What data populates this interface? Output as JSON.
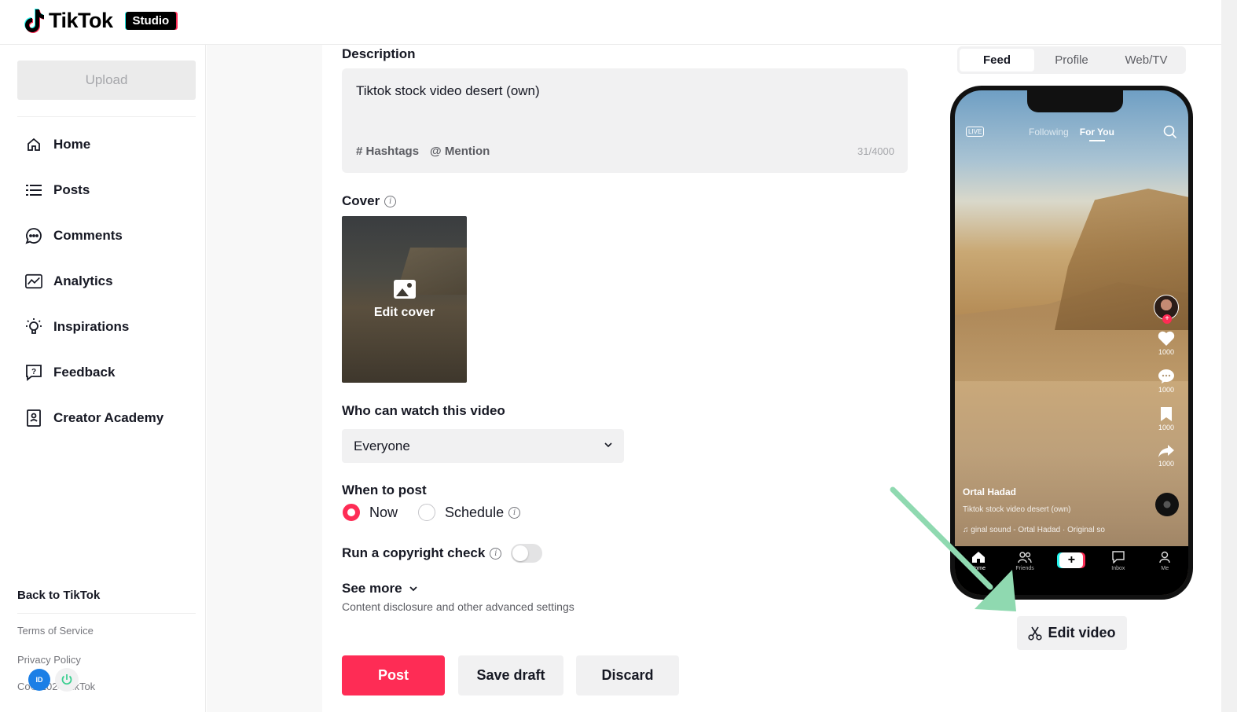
{
  "brand": {
    "logo_text": "TikTok",
    "badge": "Studio"
  },
  "sidebar": {
    "upload_label": "Upload",
    "items": [
      {
        "label": "Home",
        "icon": "home-icon"
      },
      {
        "label": "Posts",
        "icon": "list-icon"
      },
      {
        "label": "Comments",
        "icon": "comment-icon"
      },
      {
        "label": "Analytics",
        "icon": "analytics-icon"
      },
      {
        "label": "Inspirations",
        "icon": "lightbulb-icon"
      },
      {
        "label": "Feedback",
        "icon": "feedback-icon"
      },
      {
        "label": "Creator Academy",
        "icon": "academy-icon"
      }
    ],
    "back_label": "Back to TikTok",
    "terms": "Terms of Service",
    "privacy": "Privacy Policy",
    "copyright": "Co© 2024 TikTok"
  },
  "form": {
    "description_label": "Description",
    "description_value": "Tiktok stock video desert (own)",
    "hashtags_label": "Hashtags",
    "mention_label": "Mention",
    "char_count": "31/4000",
    "cover_label": "Cover",
    "edit_cover_label": "Edit cover",
    "who_label": "Who can watch this video",
    "who_value": "Everyone",
    "when_label": "When to post",
    "now_label": "Now",
    "schedule_label": "Schedule",
    "copyright_label": "Run a copyright check",
    "copyright_enabled": false,
    "see_more_label": "See more",
    "see_more_sub": "Content disclosure and other advanced settings",
    "post_label": "Post",
    "save_draft_label": "Save draft",
    "discard_label": "Discard"
  },
  "preview": {
    "tabs": [
      "Feed",
      "Profile",
      "Web/TV"
    ],
    "active_tab": "Feed",
    "live": "LIVE",
    "following": "Following",
    "for_you": "For You",
    "likes": "1000",
    "comments": "1000",
    "saves": "1000",
    "shares": "1000",
    "username": "Ortal Hadad",
    "caption": "Tiktok stock video desert (own)",
    "sound": "♫ ginal sound - Ortal Hadad · Original so",
    "nav": [
      "Home",
      "Friends",
      "",
      "Inbox",
      "Me"
    ],
    "edit_video_label": "Edit video"
  },
  "colors": {
    "accent": "#fe2c55",
    "arrow": "#8fd9b0"
  }
}
